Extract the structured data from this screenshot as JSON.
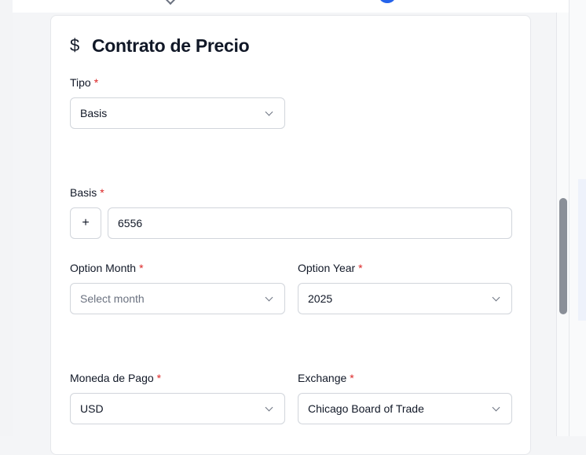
{
  "form": {
    "title": "Contrato de Precio",
    "title_icon": "dollar-icon",
    "required_marker": "*",
    "tipo": {
      "label": "Tipo",
      "value": "Basis"
    },
    "basis": {
      "label": "Basis",
      "sign": "+",
      "value": "6556"
    },
    "option_month": {
      "label": "Option Month",
      "placeholder": "Select month"
    },
    "option_year": {
      "label": "Option Year",
      "value": "2025"
    },
    "moneda_pago": {
      "label": "Moneda de Pago",
      "value": "USD"
    },
    "exchange": {
      "label": "Exchange",
      "value": "Chicago Board of Trade"
    }
  },
  "colors": {
    "required": "#dc2626",
    "accent": "#2563eb",
    "border": "#d1d5db"
  }
}
